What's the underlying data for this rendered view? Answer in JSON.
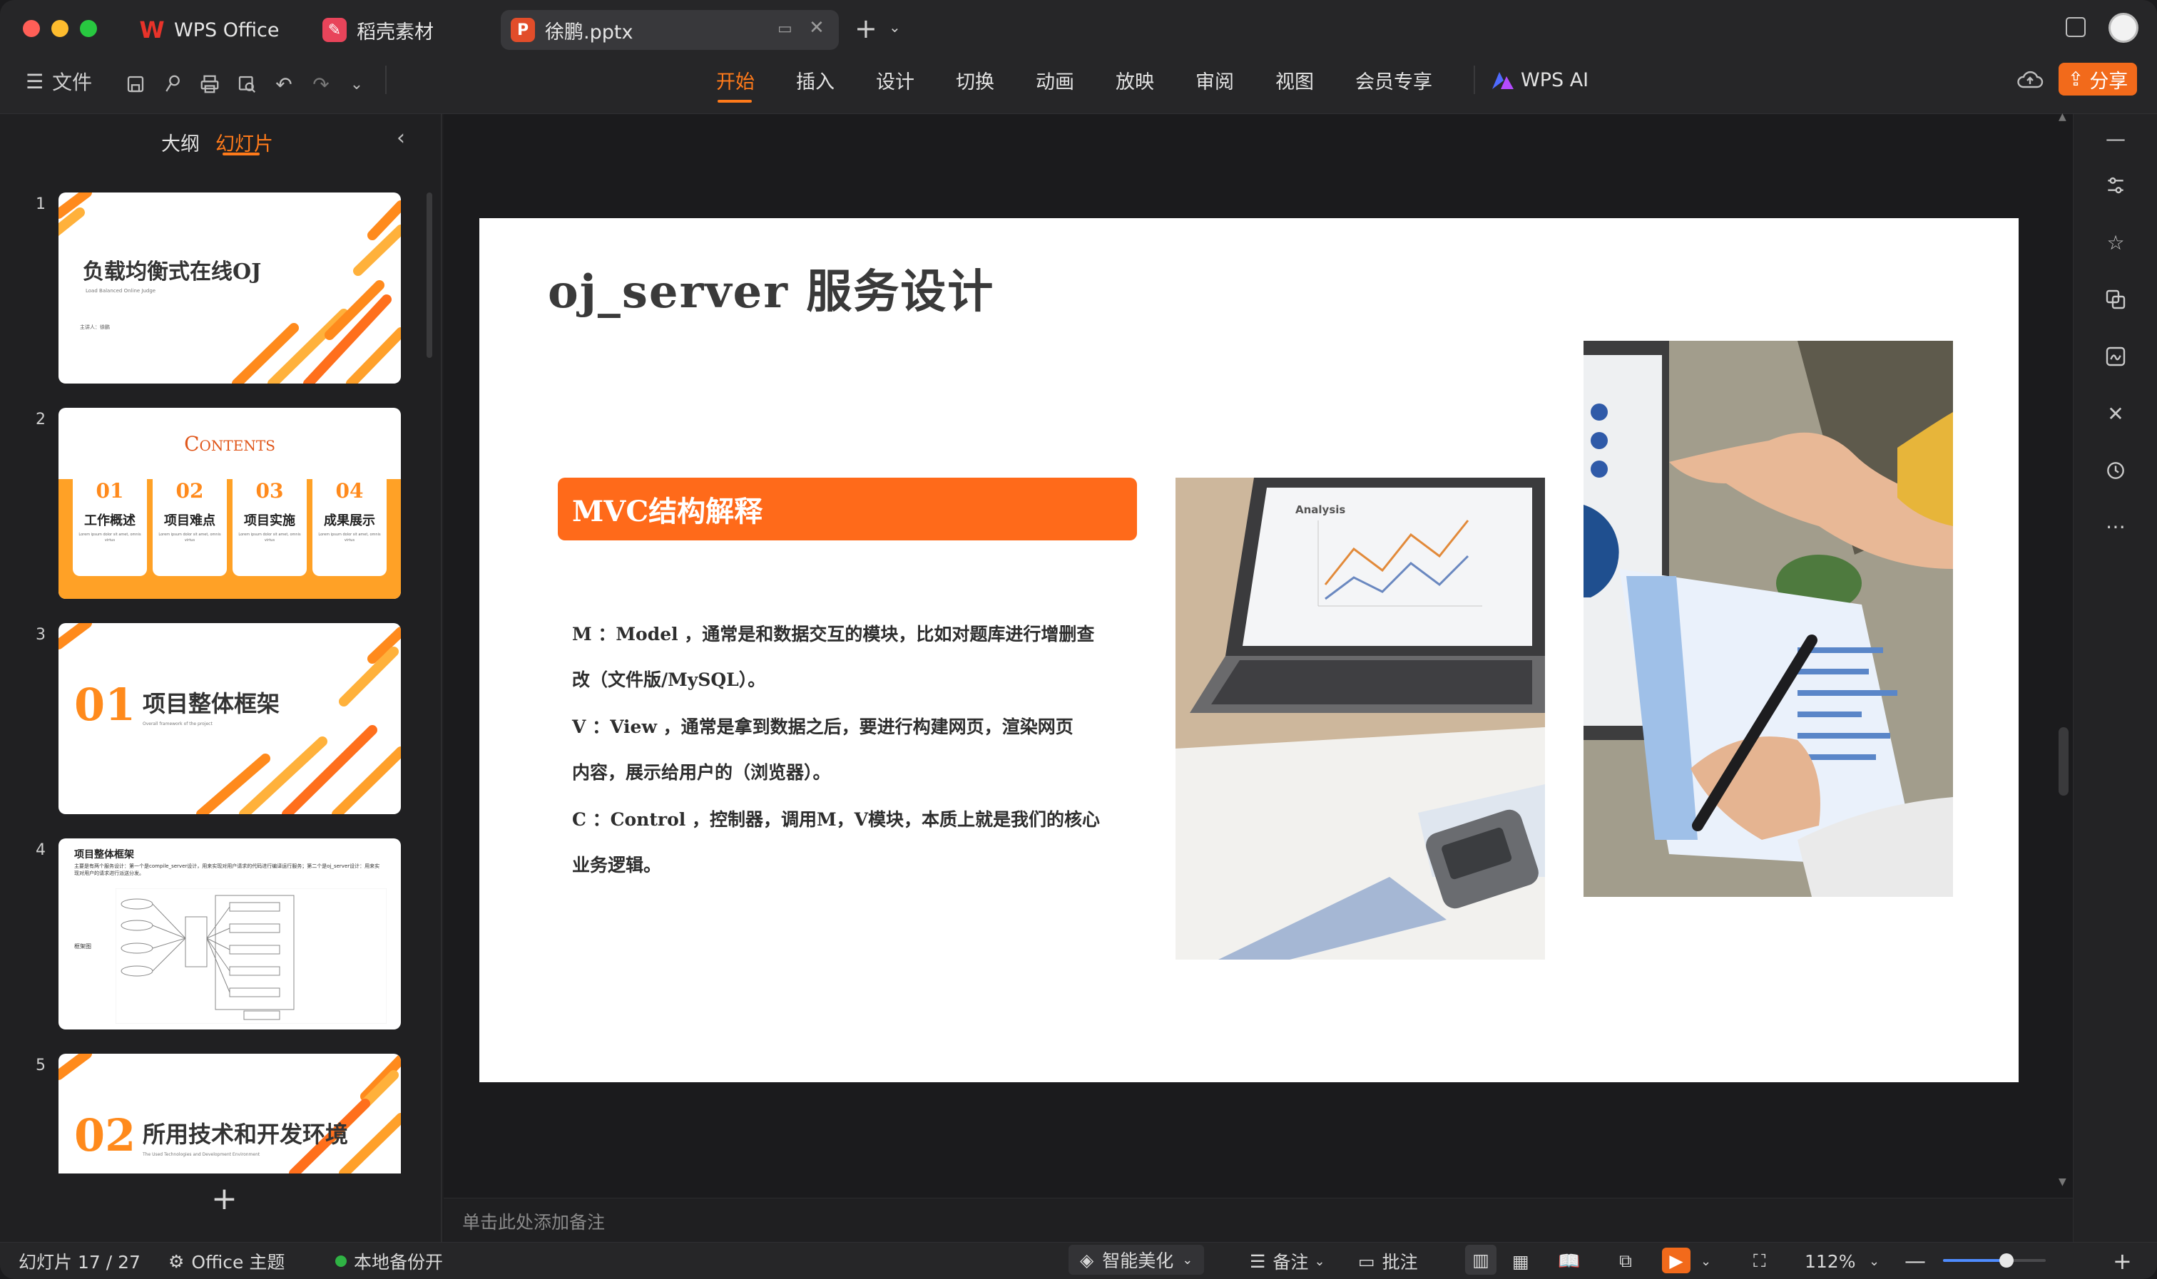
{
  "window": {
    "tabs": [
      {
        "label": "WPS Office",
        "icon": "wps-logo-icon",
        "color": "#e8332a"
      },
      {
        "label": "稻壳素材",
        "icon": "docer-icon",
        "color": "#e8445a"
      },
      {
        "label": "徐鹏.pptx",
        "icon": "ppt-icon",
        "color": "#e24d2a"
      }
    ]
  },
  "toolbar": {
    "file_label": "文件",
    "menus": [
      "开始",
      "插入",
      "设计",
      "切换",
      "动画",
      "放映",
      "审阅",
      "视图",
      "会员专享"
    ],
    "active_menu": "开始",
    "wps_ai_label": "WPS AI",
    "share_label": "分享",
    "accent": "#ff7a1a"
  },
  "left_panel": {
    "tabs": [
      "大纲",
      "幻灯片"
    ],
    "active_tab": "幻灯片",
    "slides": [
      {
        "num": "1",
        "title": "负载均衡式在线OJ",
        "subtitle": "Load Balanced Online Judge",
        "byline": "主讲人：徐鹏"
      },
      {
        "num": "2",
        "title": "Contents",
        "items": [
          {
            "no": "01",
            "label": "工作概述"
          },
          {
            "no": "02",
            "label": "项目难点"
          },
          {
            "no": "03",
            "label": "项目实施"
          },
          {
            "no": "04",
            "label": "成果展示"
          }
        ],
        "lorem": "Lorem ipsum dolor sit amet, omnis virtus"
      },
      {
        "num": "3",
        "no": "01",
        "title": "项目整体框架",
        "subtitle": "Overall framework of the project"
      },
      {
        "num": "4",
        "title": "项目整体框架",
        "desc": "主要是有两个服务设计：第一个是compile_server设计，用来实现对用户请求的代码进行编译运行服务；第二个是oj_server设计：用来实现对用户的请求进行派送分发。",
        "diagram_label": "框架图"
      },
      {
        "num": "5",
        "no": "02",
        "title": "所用技术和开发环境",
        "subtitle": "The Used Technologies and Development Environment"
      }
    ]
  },
  "slide": {
    "title": "oj_server 服务设计",
    "banner": "MVC结构解释",
    "lines": [
      "M ：Model ，通常是和数据交互的模块，比如对题库进行增删查",
      "改（文件版/MySQL）。",
      "V ：View ，通常是拿到数据之后，要进行构建网页，渲染网页",
      "内容，展示给用户的（浏览器）。",
      "C ：Control ，控制器，调用M，V模块，本质上就是我们的核心",
      "业务逻辑。"
    ],
    "chart_label": "Analysis",
    "banner_color": "#ff6a1a"
  },
  "notes": {
    "placeholder": "单击此处添加备注"
  },
  "status": {
    "slide_counter": "幻灯片 17 / 27",
    "theme": "Office 主题",
    "backup": "本地备份开",
    "beautify": "智能美化",
    "notes": "备注",
    "comments": "批注",
    "zoom": "112%",
    "zoom_level": 0.62
  }
}
